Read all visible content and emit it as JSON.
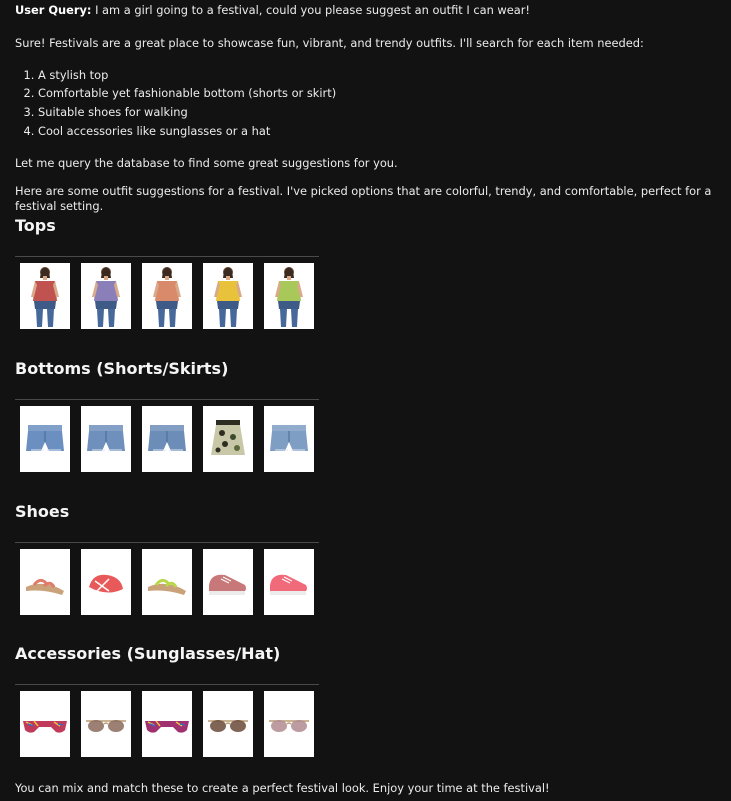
{
  "user_query": {
    "label": "User Query:",
    "text": " I am a girl going to a festival, could you please suggest an outfit I can wear!"
  },
  "intro": "Sure! Festivals are a great place to showcase fun, vibrant, and trendy outfits. I'll search for each item needed:",
  "items": [
    "A stylish top",
    "Comfortable yet fashionable bottom (shorts or skirt)",
    "Suitable shoes for walking",
    "Cool accessories like sunglasses or a hat"
  ],
  "query_note": "Let me query the database to find some great suggestions for you.",
  "summary": "Here are some outfit suggestions for a festival. I've picked options that are colorful, trendy, and comfortable, perfect for a festival setting.",
  "sections": [
    {
      "title": "Tops",
      "products": [
        {
          "icon": "model-top-icon",
          "color": "#c0524f"
        },
        {
          "icon": "model-top-icon",
          "color": "#8a7fb8"
        },
        {
          "icon": "model-top-icon",
          "color": "#d88a6a"
        },
        {
          "icon": "model-top-icon",
          "color": "#e8c23a"
        },
        {
          "icon": "model-top-icon",
          "color": "#a8c85a"
        }
      ]
    },
    {
      "title": "Bottoms (Shorts/Skirts)",
      "products": [
        {
          "icon": "denim-shorts-icon",
          "color": "#6a8fc0"
        },
        {
          "icon": "denim-shorts-icon",
          "color": "#6f8fbc"
        },
        {
          "icon": "denim-shorts-icon",
          "color": "#6c8db8"
        },
        {
          "icon": "floral-skirt-icon",
          "color": "#c8c8a8"
        },
        {
          "icon": "denim-shorts-icon",
          "color": "#7e9ec4"
        }
      ]
    },
    {
      "title": "Shoes",
      "products": [
        {
          "icon": "sandal-icon",
          "color": "#e07a6a"
        },
        {
          "icon": "flat-shoe-icon",
          "color": "#e85a5a"
        },
        {
          "icon": "sandal-icon",
          "color": "#b8d84a"
        },
        {
          "icon": "sneaker-icon",
          "color": "#c87878"
        },
        {
          "icon": "sneaker-icon",
          "color": "#f06a7a"
        }
      ]
    },
    {
      "title": "Accessories (Sunglasses/Hat)",
      "products": [
        {
          "icon": "printed-sunglasses-icon",
          "color": "#c03a5a"
        },
        {
          "icon": "sunglasses-icon",
          "color": "#8a6a5a"
        },
        {
          "icon": "printed-sunglasses-icon",
          "color": "#a03070"
        },
        {
          "icon": "sunglasses-icon",
          "color": "#6a4a3a"
        },
        {
          "icon": "sunglasses-icon",
          "color": "#b08a90"
        }
      ]
    }
  ],
  "outro": "You can mix and match these to create a perfect festival look. Enjoy your time at the festival!"
}
